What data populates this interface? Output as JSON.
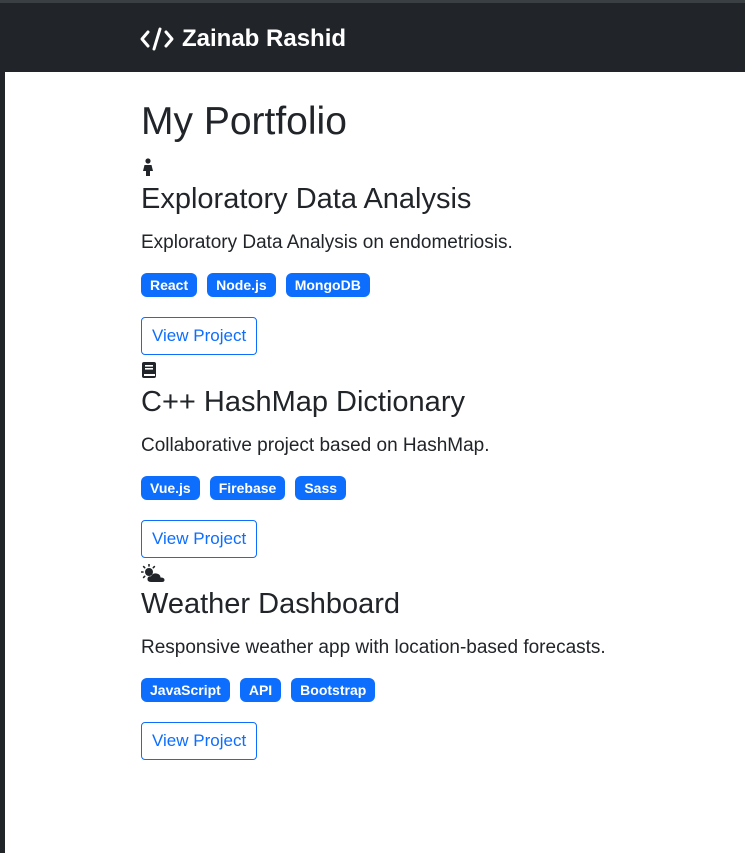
{
  "navbar": {
    "brand": "Zainab Rashid",
    "brand_icon": "code-icon"
  },
  "page": {
    "title": "My Portfolio"
  },
  "colors": {
    "navbar_bg": "#212529",
    "accent": "#0d6efd",
    "text": "#212529"
  },
  "projects": [
    {
      "icon": "female-figure-icon",
      "title": "Exploratory Data Analysis",
      "description": "Exploratory Data Analysis on endometriosis.",
      "tags": [
        "React",
        "Node.js",
        "MongoDB"
      ],
      "button": "View Project"
    },
    {
      "icon": "book-icon",
      "title": "C++ HashMap Dictionary",
      "description": "Collaborative project based on HashMap.",
      "tags": [
        "Vue.js",
        "Firebase",
        "Sass"
      ],
      "button": "View Project"
    },
    {
      "icon": "cloud-sun-icon",
      "title": "Weather Dashboard",
      "description": "Responsive weather app with location-based forecasts.",
      "tags": [
        "JavaScript",
        "API",
        "Bootstrap"
      ],
      "button": "View Project"
    }
  ]
}
